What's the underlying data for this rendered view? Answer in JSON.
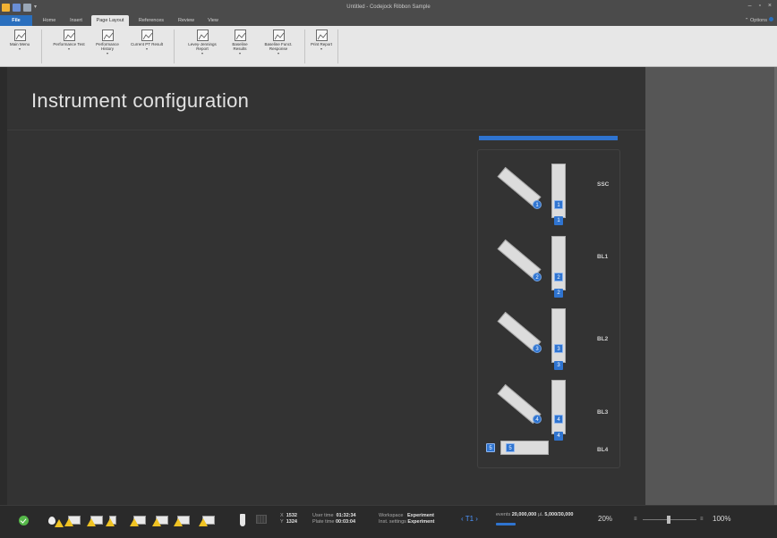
{
  "titlebar": {
    "window_title": "Untitled - Codejock Ribbon Sample",
    "controls": "– ▫ ×"
  },
  "tabs": {
    "file": "File",
    "items": [
      "Home",
      "Insert",
      "Page Layout",
      "References",
      "Review",
      "View"
    ],
    "active": "Page Layout",
    "options": "Options"
  },
  "ribbon": {
    "buttons": [
      {
        "label": "Main Menu"
      },
      {
        "label": "Performance Test"
      },
      {
        "label": "Performance History"
      },
      {
        "label": "Current PT Result"
      },
      {
        "label": "Levey-Jennings Report"
      },
      {
        "label": "Baseline Results"
      },
      {
        "label": "Baseline Funct. Response"
      },
      {
        "label": "Print Report"
      }
    ],
    "dropdown_glyph": "▾"
  },
  "main": {
    "title": "Instrument configuration",
    "accent": "#2f74d0"
  },
  "instrument": {
    "mirrors": [
      {
        "num": "1"
      },
      {
        "num": "2"
      },
      {
        "num": "3"
      },
      {
        "num": "4"
      }
    ],
    "filters": [
      {
        "num": "1",
        "sub": "1"
      },
      {
        "num": "2",
        "sub": "2"
      },
      {
        "num": "3",
        "sub": "3"
      },
      {
        "num": "4",
        "sub": "4"
      }
    ],
    "detectors": [
      "SSC",
      "BL1",
      "BL2",
      "BL3",
      "BL4"
    ],
    "bl4_badges": [
      "5",
      "5"
    ]
  },
  "statusbar": {
    "coords": {
      "x_label": "X",
      "x": "1532",
      "y_label": "Y",
      "y": "1324"
    },
    "user_time_label": "User time",
    "user_time": "01:32:34",
    "plate_time_label": "Plate time",
    "plate_time": "00:03:04",
    "workspace_label": "Workspace",
    "workspace": "Experiment",
    "inst_settings_label": "Inst. settings",
    "inst_settings": "Experiment",
    "tube_nav": "‹ T1 ›",
    "events_label": "events",
    "events": "20,000,000",
    "volume_unit": "µL",
    "volume": "5,000/30,000",
    "progress_fraction": 0.2,
    "percent": "20%",
    "zoom": "100%",
    "ok_color": "#56b84a",
    "warn_color": "#f0c323"
  }
}
